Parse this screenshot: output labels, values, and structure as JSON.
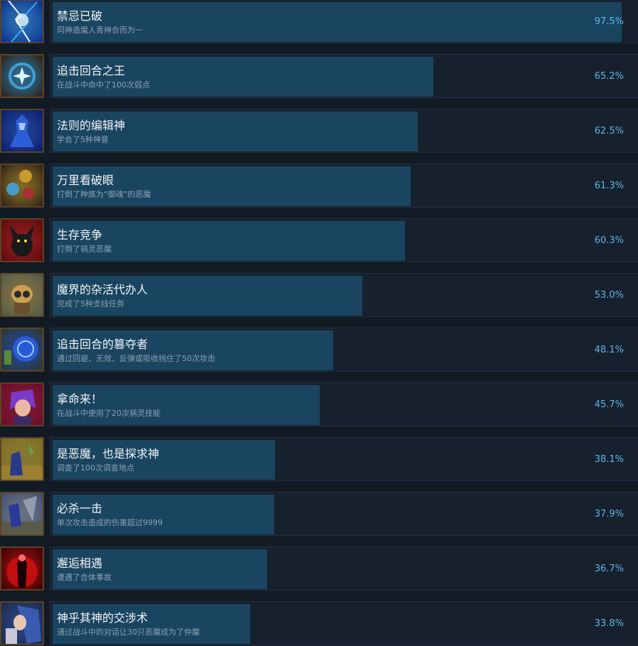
{
  "colors": {
    "background": "#121a24",
    "track": "#16212d",
    "fill": "#1a4560",
    "percent_text": "#5fb3e6",
    "frame": "#5b4324"
  },
  "achievements": [
    {
      "name": "禁忌已破",
      "desc": "同神造魔人青神合而为一",
      "percent_label": "97.5%",
      "percent": 97.5,
      "icon": "blue-lightning-icon",
      "icon_colors": [
        "#0a2a8a",
        "#3fa8ff",
        "#e8f6ff"
      ]
    },
    {
      "name": "追击回合之王",
      "desc": "在战斗中命中了100次弱点",
      "percent_label": "65.2%",
      "percent": 65.2,
      "icon": "compass-star-icon",
      "icon_colors": [
        "#2a1d10",
        "#3ea0d8",
        "#d9f2ff"
      ]
    },
    {
      "name": "法则的编辑神",
      "desc": "学会了5种神意",
      "percent_label": "62.5%",
      "percent": 62.5,
      "icon": "blue-demon-icon",
      "icon_colors": [
        "#0a1a66",
        "#2d5ed8",
        "#a8c8ff"
      ]
    },
    {
      "name": "万里看破眼",
      "desc": "打倒了种族为“御魂”的恶魔",
      "percent_label": "61.3%",
      "percent": 61.3,
      "icon": "three-spirits-icon",
      "icon_colors": [
        "#2a1f14",
        "#c79a2a",
        "#4a9ac8"
      ]
    },
    {
      "name": "生存竞争",
      "desc": "打倒了祸灵恶魔",
      "percent_label": "60.3%",
      "percent": 60.3,
      "icon": "red-imp-icon",
      "icon_colors": [
        "#5a0a0a",
        "#d42020",
        "#1a1a1a"
      ]
    },
    {
      "name": "魔界的杂活代办人",
      "desc": "完成了5种支线任务",
      "percent_label": "53.0%",
      "percent": 53.0,
      "icon": "goggle-creature-icon",
      "icon_colors": [
        "#4a5a4a",
        "#c8a050",
        "#2a2a2a"
      ]
    },
    {
      "name": "追击回合的篡夺者",
      "desc": "通过回避、无效、反弹或吸收挡住了50次攻击",
      "percent_label": "48.1%",
      "percent": 48.1,
      "icon": "blue-shield-icon",
      "icon_colors": [
        "#2a3a2a",
        "#2a5ad8",
        "#9ad0ff"
      ]
    },
    {
      "name": "拿命来！",
      "desc": "在战斗中使用了20次祸灵技能",
      "percent_label": "45.7%",
      "percent": 45.7,
      "icon": "purple-hair-fighter-icon",
      "icon_colors": [
        "#6a0a2a",
        "#b41e3c",
        "#7a3ac8"
      ]
    },
    {
      "name": "是恶魔，也是探求神",
      "desc": "调查了100次调查地点",
      "percent_label": "38.1%",
      "percent": 38.1,
      "icon": "desert-explorer-icon",
      "icon_colors": [
        "#7a6a20",
        "#c8b040",
        "#2a3a8a"
      ]
    },
    {
      "name": "必杀一击",
      "desc": "单次攻击造成的伤害超过9999",
      "percent_label": "37.9%",
      "percent": 37.9,
      "icon": "battle-strike-icon",
      "icon_colors": [
        "#3a4a6a",
        "#a0a8b8",
        "#2a3a9a"
      ]
    },
    {
      "name": "邂逅相遇",
      "desc": "遭遇了合体事故",
      "percent_label": "36.7%",
      "percent": 36.7,
      "icon": "red-glow-figure-icon",
      "icon_colors": [
        "#3a0000",
        "#e01010",
        "#ff6a6a"
      ]
    },
    {
      "name": "神乎其神的交涉术",
      "desc": "通过战斗中的对话让30只恶魔成为了仲魔",
      "percent_label": "33.8%",
      "percent": 33.8,
      "icon": "blue-hair-warrior-icon",
      "icon_colors": [
        "#1a2a4a",
        "#3a5ab0",
        "#c8c8d8"
      ]
    }
  ]
}
